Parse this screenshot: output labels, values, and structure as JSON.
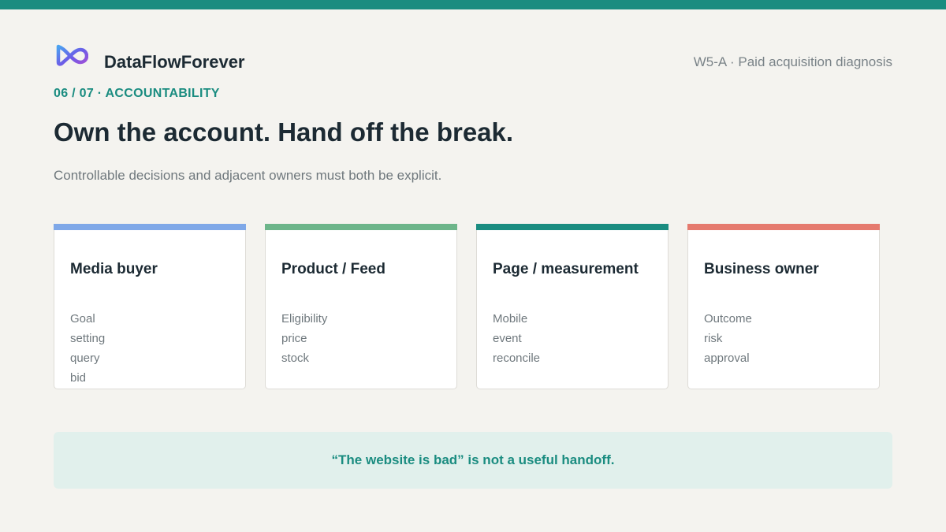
{
  "colors": {
    "top_bar": "#1a8c80",
    "accent_text": "#1a8c80",
    "card_media_buyer": "#7fa8e8",
    "card_product_feed": "#6db58a",
    "card_page_measurement": "#1a8c80",
    "card_business_owner": "#e57a6e",
    "quote_background": "#e1f0ec"
  },
  "header": {
    "logo_icon": "infinity-logo-icon",
    "brand": "DataFlowForever",
    "deck_label": "W5-A · Paid acquisition diagnosis"
  },
  "section_label": "06 / 07 · ACCOUNTABILITY",
  "title": "Own the account. Hand off the break.",
  "subtitle": "Controllable decisions and adjacent owners must both be explicit.",
  "cards": [
    {
      "title": "Media buyer",
      "items": [
        "Goal",
        "setting",
        "query",
        "bid"
      ]
    },
    {
      "title": "Product / Feed",
      "items": [
        "Eligibility",
        "price",
        "stock"
      ]
    },
    {
      "title": "Page / measurement",
      "items": [
        "Mobile",
        "event",
        "reconcile"
      ]
    },
    {
      "title": "Business owner",
      "items": [
        "Outcome",
        "risk",
        "approval"
      ]
    }
  ],
  "callout": "“The website is bad” is not a useful handoff."
}
